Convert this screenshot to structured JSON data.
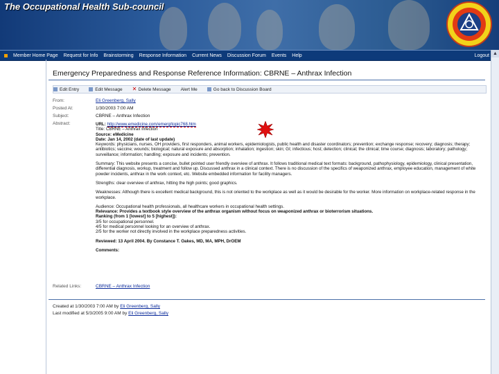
{
  "banner": {
    "title": "The Occupational Health Sub-council"
  },
  "nav": {
    "items": [
      "Member Home Page",
      "Request for Info",
      "Brainstorming",
      "Response Information",
      "Current News",
      "Discussion Forum",
      "Events",
      "Help"
    ],
    "logout": "Logout"
  },
  "page": {
    "title": "Emergency Preparedness and Response Reference Information: CBRNE – Anthrax Infection"
  },
  "toolbar": {
    "items": [
      "Edit Entry",
      "Edit Message",
      "Delete Message",
      "Alert Me",
      "Go back to Discussion Board"
    ]
  },
  "fields": {
    "from_label": "From:",
    "from_value": "Eli Greenberg, Sally",
    "posted_label": "Posted At:",
    "posted_value": "1/30/2003 7:00 AM",
    "subject_label": "Subject:",
    "subject_value": "CBRNE – Anthrax Infection",
    "abstract_label": "Abstract:"
  },
  "abstract": {
    "url_label": "URL:",
    "url_value": "http://www.emedicine.com/emerg/topic768.htm",
    "title_line": "Title: CBRNE – Anthrax Infection",
    "source": "Source: eMedicine",
    "date": "Date: Jan 14, 2002 (date of last update)",
    "keywords": "Keywords: physicians, nurses, OH providers, first responders, animal workers, epidemiologists, public health and disaster coordinators; prevention; exchange response; recovery; diagnosis; therapy; antibiotics; vaccine; wounds; biological; natural exposure and absorption; inhalation; ingestion; skin; GI; infectious; host; detection; clinical; the clinical; time course; diagnosis; laboratory; pathology; surveillance; information; handling; exposure and incidents; prevention.",
    "summary": "Summary: This website presents a concise, bullet pointed user friendly overview of anthrax. It follows traditional medical text formats: background, pathophysiology, epidemiology, clinical presentation, differential diagnosis, workup, treatment and follow up. Discussed anthrax in a clinical context. There is no discussion of the specifics of weaponized anthrax, employee education, management of white powder incidents, anthrax in the work context, etc. Website embedded information for facility managers.",
    "strengths": "Strengths: clear overview of anthrax, hitting the high points; good graphics.",
    "weaknesses": "Weaknesses: Although there is excellent medical background, this is not oriented to the workplace as well as it would be desirable for the worker. More information on workplace-related response in the workplace.",
    "audience": "Audience: Occupational health professionals, all healthcare workers in occupational health settings.",
    "relevance": "Relevance: Provides a textbook style overview of the anthrax organism without focus on weaponized anthrax or bioterrorism situations.",
    "ranking": "Ranking (from 1 [lowest] to 5 [highest]):",
    "rank1": "3/5 for occupational personnel.",
    "rank2": "4/5 for medical personnel looking for an overview of anthrax.",
    "rank3": "2/5 for the worker not directly involved in the workplace preparedness activities.",
    "reviewed": "Reviewed: 13 April 2004. By Constance T. Oakes, MD, MA, MPH, DrOEM",
    "comments": "Comments:"
  },
  "related": {
    "label": "Related Links:",
    "value": "CBRNE – Anthrax Infection"
  },
  "footer": {
    "created_prefix": "Created at 1/30/2003 7:00 AM by",
    "created_by": "Eli Greenberg, Sally",
    "modified_prefix": "Last modified at 5/3/2005 9:00 AM by",
    "modified_by": "Eli Greenberg, Sally"
  }
}
